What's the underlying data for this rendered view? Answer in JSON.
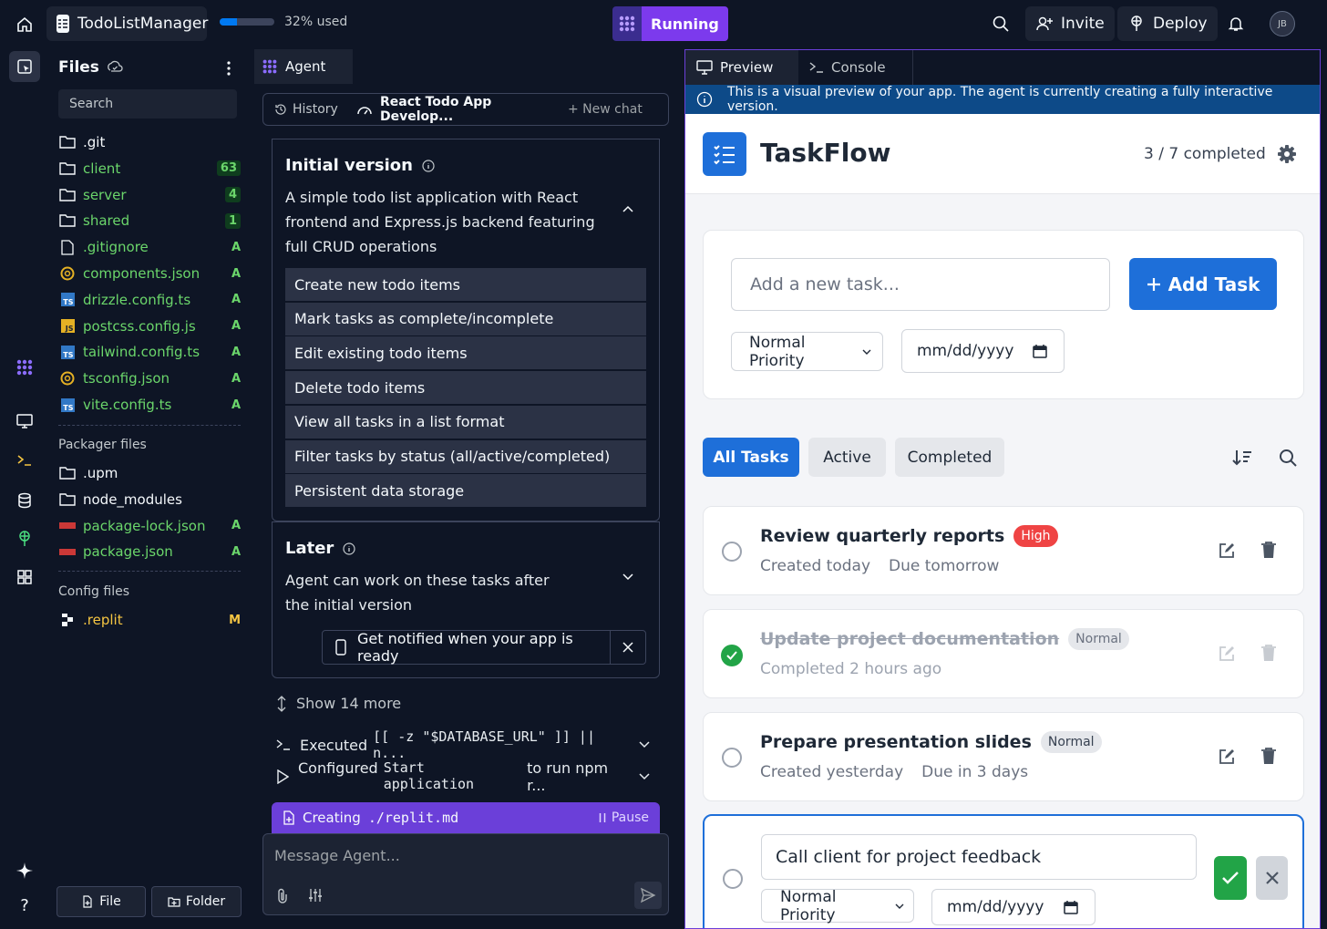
{
  "topbar": {
    "project_name": "TodoListManager",
    "usage_percent": 32,
    "usage_label": "32% used",
    "run_status": "Running",
    "invite_label": "Invite",
    "deploy_label": "Deploy",
    "avatar_initials": "JB"
  },
  "files": {
    "title": "Files",
    "search_placeholder": "Search",
    "items": [
      {
        "name": ".git",
        "badge": "",
        "color": "#f5f9fc"
      },
      {
        "name": "client",
        "badge": "63",
        "color": "#6bd66b"
      },
      {
        "name": "server",
        "badge": "4",
        "color": "#6bd66b"
      },
      {
        "name": "shared",
        "badge": "1",
        "color": "#6bd66b"
      },
      {
        "name": ".gitignore",
        "badge": "A",
        "color": "#6bd66b"
      },
      {
        "name": "components.json",
        "badge": "A",
        "color": "#6bd66b"
      },
      {
        "name": "drizzle.config.ts",
        "badge": "A",
        "color": "#6bd66b"
      },
      {
        "name": "postcss.config.js",
        "badge": "A",
        "color": "#6bd66b"
      },
      {
        "name": "tailwind.config.ts",
        "badge": "A",
        "color": "#6bd66b"
      },
      {
        "name": "tsconfig.json",
        "badge": "A",
        "color": "#6bd66b"
      },
      {
        "name": "vite.config.ts",
        "badge": "A",
        "color": "#6bd66b"
      }
    ],
    "packager_title": "Packager files",
    "packager_items": [
      {
        "name": ".upm",
        "badge": ""
      },
      {
        "name": "node_modules",
        "badge": ""
      },
      {
        "name": "package-lock.json",
        "badge": "A"
      },
      {
        "name": "package.json",
        "badge": "A"
      }
    ],
    "config_title": "Config files",
    "config_items": [
      {
        "name": ".replit",
        "badge": "M"
      }
    ],
    "new_file_label": "File",
    "new_folder_label": "Folder"
  },
  "agent": {
    "tab_label": "Agent",
    "history_label": "History",
    "chat_title": "React Todo App Develop...",
    "new_chat_label": "+ New chat",
    "initial": {
      "title": "Initial version",
      "description": "A simple todo list application with React frontend and Express.js backend featuring full CRUD operations",
      "tasks": [
        "Create new todo items",
        "Mark tasks as complete/incomplete",
        "Edit existing todo items",
        "Delete todo items",
        "View all tasks in a list format",
        "Filter tasks by status (all/active/completed)",
        "Persistent data storage"
      ]
    },
    "later": {
      "title": "Later",
      "description": "Agent can work on these tasks after the initial version",
      "notify_label": "Get notified when your app is ready"
    },
    "show_more": "Show 14 more",
    "executed_prefix": "Executed",
    "executed_cmd": "[[ -z \"$DATABASE_URL\" ]] || n...",
    "configured_prefix": "Configured",
    "configured_cmd": "Start application",
    "configured_suffix": "to run npm r...",
    "creating_prefix": "Creating",
    "creating_file": "./replit.md",
    "pause_label": "Pause",
    "message_placeholder": "Message Agent..."
  },
  "preview": {
    "tab_preview": "Preview",
    "tab_console": "Console",
    "info_text": "This is a visual preview of your app. The agent is currently creating a fully interactive version.",
    "app_title": "TaskFlow",
    "completed_count": "3 / 7 completed",
    "new_task_placeholder": "Add a new task...",
    "add_task_label": "Add Task",
    "priority_label": "Normal Priority",
    "date_placeholder": "mm/dd/yyyy",
    "filters": [
      "All Tasks",
      "Active",
      "Completed"
    ],
    "tasks": [
      {
        "title": "Review quarterly reports",
        "badge": "High",
        "created": "Created today",
        "due": "Due tomorrow",
        "completed": false
      },
      {
        "title": "Update project documentation",
        "badge": "Normal",
        "created": "Completed 2 hours ago",
        "due": "",
        "completed": true
      },
      {
        "title": "Prepare presentation slides",
        "badge": "Normal",
        "created": "Created yesterday",
        "due": "Due in 3 days",
        "completed": false
      }
    ],
    "editing_task": {
      "title_value": "Call client for project feedback",
      "priority": "Normal Priority",
      "date_placeholder": "mm/dd/yyyy"
    },
    "colors": {
      "accent": "#1e6fd9",
      "high": "#ef4444",
      "save": "#22a447"
    }
  }
}
